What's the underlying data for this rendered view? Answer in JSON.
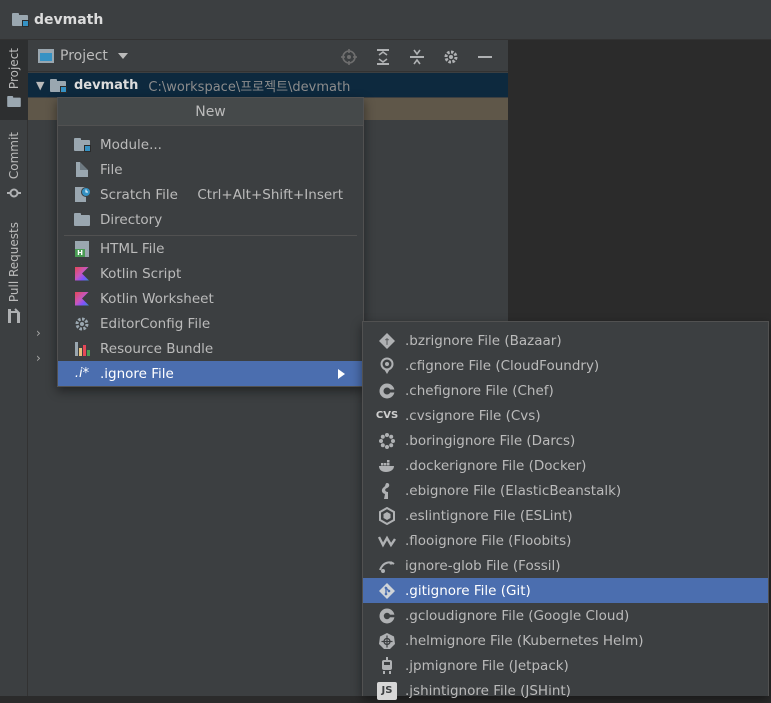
{
  "window": {
    "title": "devmath"
  },
  "side_tabs": {
    "project": "Project",
    "commit": "Commit",
    "pull_requests": "Pull Requests"
  },
  "project_panel": {
    "title": "Project",
    "root": {
      "name": "devmath",
      "path": "C:\\workspace\\프로젝트\\devmath"
    }
  },
  "new_menu": {
    "header": "New",
    "items": [
      {
        "label": "Module...",
        "icon": "module-icon",
        "shortcut": ""
      },
      {
        "label": "File",
        "icon": "file-icon",
        "shortcut": ""
      },
      {
        "label": "Scratch File",
        "icon": "scratch-file-icon",
        "shortcut": "Ctrl+Alt+Shift+Insert"
      },
      {
        "label": "Directory",
        "icon": "folder-icon",
        "shortcut": ""
      },
      {
        "label": "HTML File",
        "icon": "html-file-icon",
        "shortcut": ""
      },
      {
        "label": "Kotlin Script",
        "icon": "kotlin-icon",
        "shortcut": ""
      },
      {
        "label": "Kotlin Worksheet",
        "icon": "kotlin-icon",
        "shortcut": ""
      },
      {
        "label": "EditorConfig File",
        "icon": "gear-icon",
        "shortcut": ""
      },
      {
        "label": "Resource Bundle",
        "icon": "resource-bundle-icon",
        "shortcut": ""
      },
      {
        "label": ".ignore File",
        "icon": "ignore-icon",
        "icon_text": ".i*",
        "shortcut": "",
        "selected": true
      }
    ]
  },
  "ignore_menu": {
    "items": [
      {
        "label": ".bzrignore File (Bazaar)",
        "icon": "bazaar-icon"
      },
      {
        "label": ".cfignore File (CloudFoundry)",
        "icon": "cloudfoundry-icon"
      },
      {
        "label": ".chefignore File (Chef)",
        "icon": "chef-icon"
      },
      {
        "label": ".cvsignore File (Cvs)",
        "icon": "cvs-icon",
        "icon_text": "CVS"
      },
      {
        "label": ".boringignore File (Darcs)",
        "icon": "darcs-icon"
      },
      {
        "label": ".dockerignore File (Docker)",
        "icon": "docker-icon"
      },
      {
        "label": ".ebignore File (ElasticBeanstalk)",
        "icon": "elasticbeanstalk-icon"
      },
      {
        "label": ".eslintignore File (ESLint)",
        "icon": "eslint-icon"
      },
      {
        "label": ".flooignore File (Floobits)",
        "icon": "floobits-icon"
      },
      {
        "label": "ignore-glob File (Fossil)",
        "icon": "fossil-icon"
      },
      {
        "label": ".gitignore File (Git)",
        "icon": "git-icon",
        "selected": true
      },
      {
        "label": ".gcloudignore File (Google Cloud)",
        "icon": "google-cloud-icon"
      },
      {
        "label": ".helmignore File (Kubernetes Helm)",
        "icon": "helm-icon"
      },
      {
        "label": ".jpmignore File (Jetpack)",
        "icon": "jetpack-icon"
      },
      {
        "label": ".jshintignore File (JSHint)",
        "icon": "jshint-icon",
        "icon_text": "JS"
      }
    ]
  },
  "colors": {
    "selection": "#4b6eaf",
    "menu_bg": "#3c3f41",
    "editor_bg": "#2b2b2b",
    "tree_selection": "#0d293e"
  }
}
